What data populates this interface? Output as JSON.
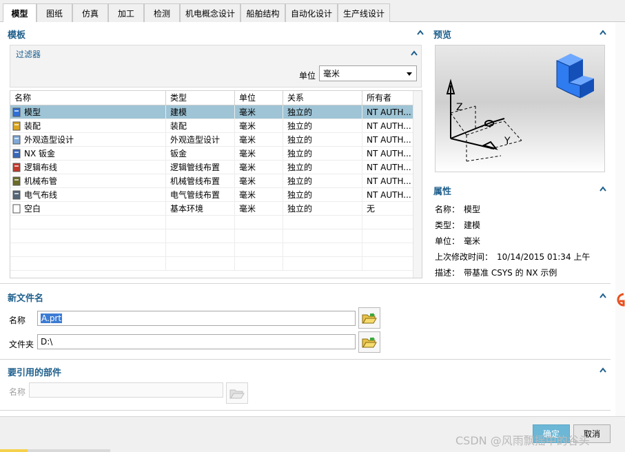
{
  "tabs": [
    {
      "label": "模型",
      "active": true
    },
    {
      "label": "图纸",
      "active": false
    },
    {
      "label": "仿真",
      "active": false
    },
    {
      "label": "加工",
      "active": false
    },
    {
      "label": "检测",
      "active": false
    },
    {
      "label": "机电概念设计",
      "active": false
    },
    {
      "label": "船舶结构",
      "active": false
    },
    {
      "label": "自动化设计",
      "active": false
    },
    {
      "label": "生产线设计",
      "active": false
    }
  ],
  "templates": {
    "title": "模板",
    "filter": {
      "title": "过滤器",
      "unit_label": "单位",
      "unit_value": "毫米"
    },
    "columns": [
      "名称",
      "类型",
      "单位",
      "关系",
      "所有者"
    ],
    "rows": [
      {
        "icon": "model-icon",
        "name": "模型",
        "type": "建模",
        "unit": "毫米",
        "relation": "独立的",
        "owner": "NT AUTH...",
        "selected": true
      },
      {
        "icon": "assembly-icon",
        "name": "装配",
        "type": "装配",
        "unit": "毫米",
        "relation": "独立的",
        "owner": "NT AUTH...",
        "selected": false
      },
      {
        "icon": "shape-studio-icon",
        "name": "外观造型设计",
        "type": "外观造型设计",
        "unit": "毫米",
        "relation": "独立的",
        "owner": "NT AUTH...",
        "selected": false
      },
      {
        "icon": "sheet-metal-icon",
        "name": "NX 钣金",
        "type": "钣金",
        "unit": "毫米",
        "relation": "独立的",
        "owner": "NT AUTH...",
        "selected": false
      },
      {
        "icon": "logical-routing-icon",
        "name": "逻辑布线",
        "type": "逻辑管线布置",
        "unit": "毫米",
        "relation": "独立的",
        "owner": "NT AUTH...",
        "selected": false
      },
      {
        "icon": "mechanical-routing-icon",
        "name": "机械布管",
        "type": "机械管线布置",
        "unit": "毫米",
        "relation": "独立的",
        "owner": "NT AUTH...",
        "selected": false
      },
      {
        "icon": "electrical-routing-icon",
        "name": "电气布线",
        "type": "电气管线布置",
        "unit": "毫米",
        "relation": "独立的",
        "owner": "NT AUTH...",
        "selected": false
      },
      {
        "icon": "blank-icon",
        "name": "空白",
        "type": "基本环境",
        "unit": "毫米",
        "relation": "独立的",
        "owner": "无",
        "selected": false
      }
    ]
  },
  "preview": {
    "title": "预览",
    "axis_z": "Z",
    "axis_y": "Y",
    "axis_x": "X"
  },
  "properties": {
    "title": "属性",
    "items": [
      {
        "key": "名称：",
        "value": "模型"
      },
      {
        "key": "类型：",
        "value": "建模"
      },
      {
        "key": "单位：",
        "value": "毫米"
      },
      {
        "key": "上次修改时间：",
        "value": "10/14/2015 01:34 上午"
      },
      {
        "key": "描述：",
        "value": "带基准 CSYS 的 NX 示例"
      }
    ]
  },
  "new_file": {
    "title": "新文件名",
    "name_label": "名称",
    "name_value": "A.prt",
    "folder_label": "文件夹",
    "folder_value": "D:\\"
  },
  "referenced_part": {
    "title": "要引用的部件",
    "name_label": "名称",
    "name_value": ""
  },
  "footer": {
    "ok_label": "确定",
    "cancel_label": "取消",
    "watermark": "CSDN @风雨飘摇中的谷头"
  },
  "colors": {
    "section_title": "#1e5f8c",
    "selected_row": "#9ec4d6",
    "ok_button": "#6cb7d6"
  }
}
